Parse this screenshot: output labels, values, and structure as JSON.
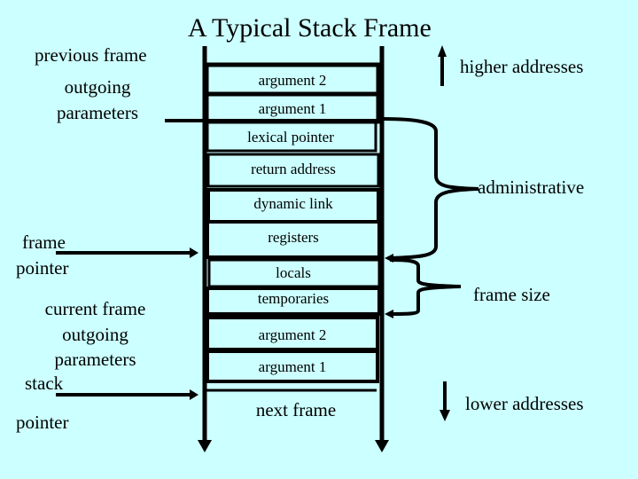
{
  "title": "A Typical Stack Frame",
  "left_labels": {
    "previous_frame": "previous frame",
    "outgoing_line1": "outgoing",
    "outgoing_line2": "parameters",
    "frame_pointer_line1": "frame",
    "frame_pointer_line2": "pointer",
    "current_frame_line1": "current frame",
    "current_frame_line2": "outgoing",
    "current_frame_line3": "parameters",
    "stack_pointer_line1": "stack",
    "stack_pointer_line2": "pointer"
  },
  "stack_slots": [
    "argument 2",
    "argument 1",
    "lexical pointer",
    "return address",
    "dynamic link",
    "registers",
    "locals",
    "temporaries",
    "argument 2",
    "argument 1"
  ],
  "next_frame": "next frame",
  "right_labels": {
    "higher": "higher addresses",
    "administrative": "administrative",
    "frame_size": "frame size",
    "lower": "lower addresses"
  },
  "colors": {
    "background": "#ccffff",
    "ink": "#000000"
  }
}
